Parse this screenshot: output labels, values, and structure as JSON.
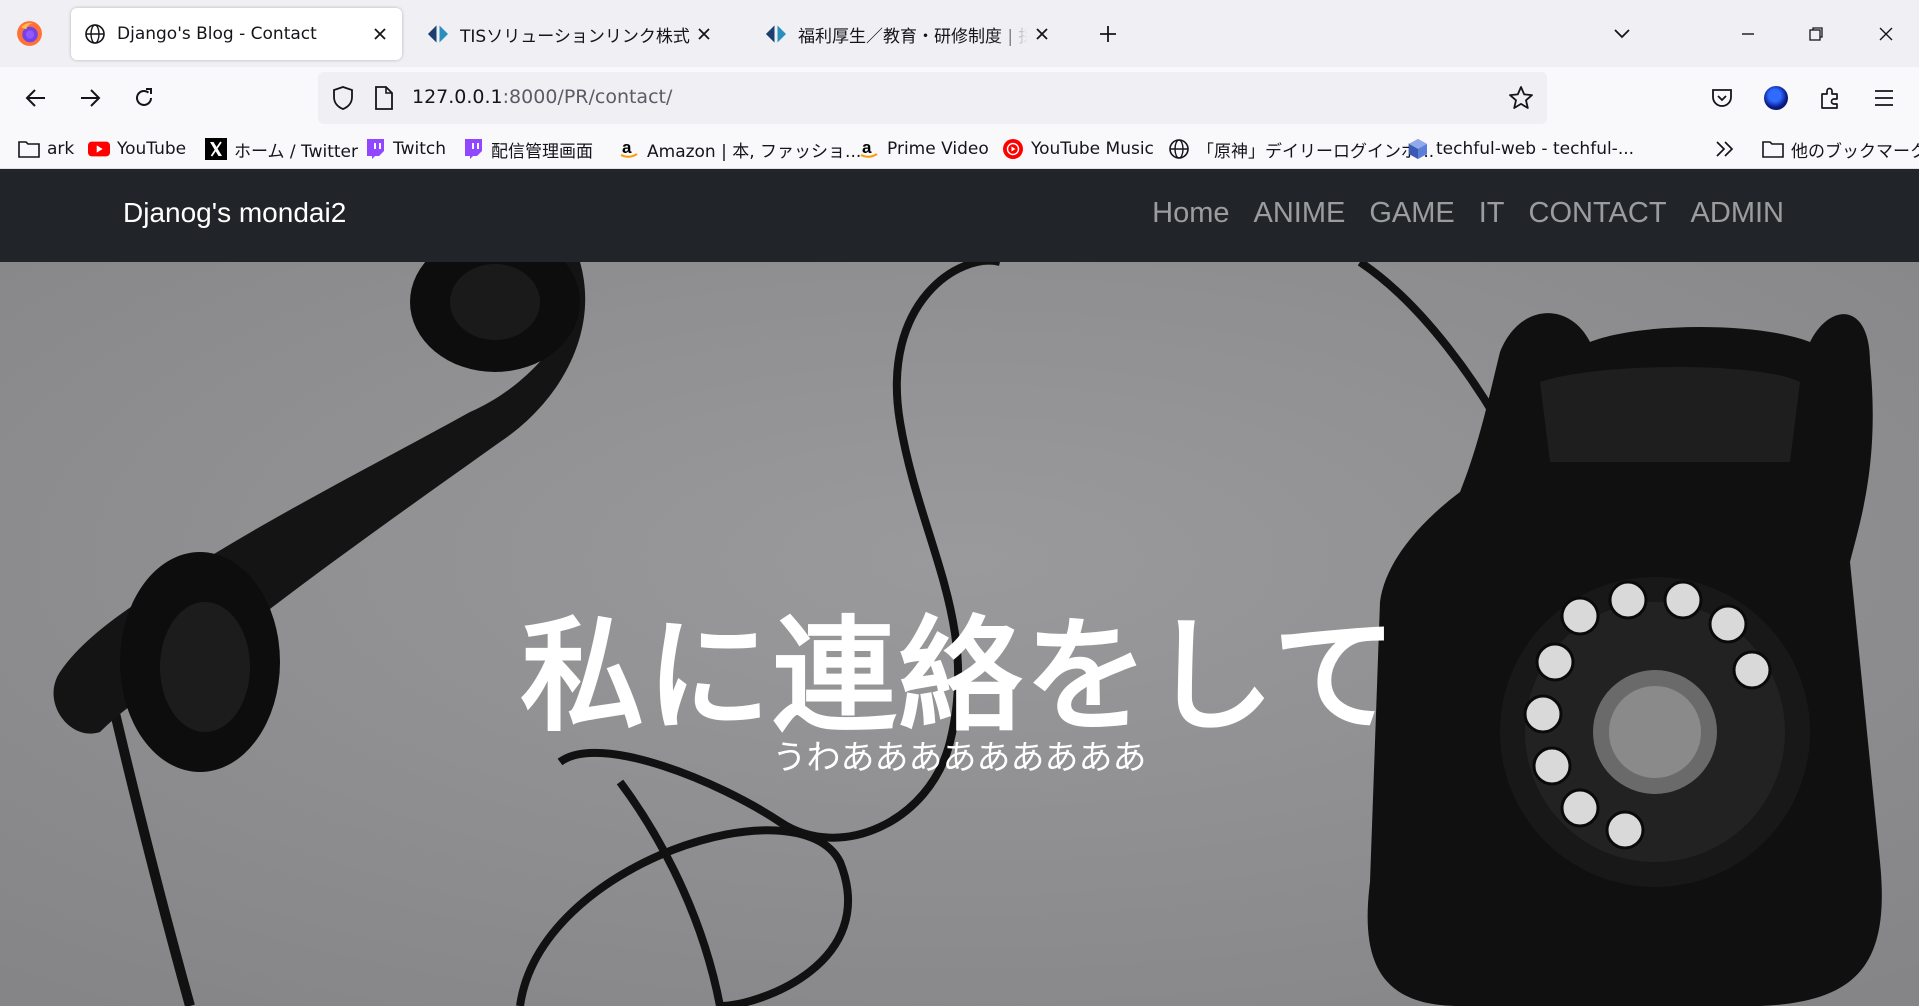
{
  "browser": {
    "tabs": [
      {
        "label": "Django's Blog - Contact",
        "icon": "globe-icon",
        "active": true
      },
      {
        "label": "TISソリューションリンク株式会社",
        "icon": "tis-logo-icon",
        "active": false
      },
      {
        "label": "福利厚生／教育・研修制度 | 採用",
        "icon": "tis-logo-icon",
        "active": false
      }
    ],
    "url": {
      "host": "127.0.0.1",
      "rest": ":8000/PR/contact/"
    },
    "bookmarks": [
      {
        "label": "ark",
        "icon": "folder-icon"
      },
      {
        "label": "YouTube",
        "icon": "youtube-icon"
      },
      {
        "label": "ホーム / Twitter",
        "icon": "x-icon"
      },
      {
        "label": "Twitch",
        "icon": "twitch-icon"
      },
      {
        "label": "配信管理画面",
        "icon": "twitch-icon"
      },
      {
        "label": "Amazon | 本, ファッショ...",
        "icon": "amazon-icon"
      },
      {
        "label": "Prime Video",
        "icon": "amazon-icon"
      },
      {
        "label": "YouTube Music",
        "icon": "youtube-music-icon"
      },
      {
        "label": "「原神」デイリーログインボ...",
        "icon": "globe-icon"
      },
      {
        "label": "techful-web - techful-...",
        "icon": "techful-icon"
      }
    ],
    "other_bookmarks": "他のブックマーク"
  },
  "site": {
    "brand": "Djanog's mondai2",
    "nav": [
      "Home",
      "ANIME",
      "GAME",
      "IT",
      "CONTACT",
      "ADMIN"
    ],
    "hero_title": "私に連絡をして",
    "hero_subtitle": "うわあああああああああ"
  }
}
